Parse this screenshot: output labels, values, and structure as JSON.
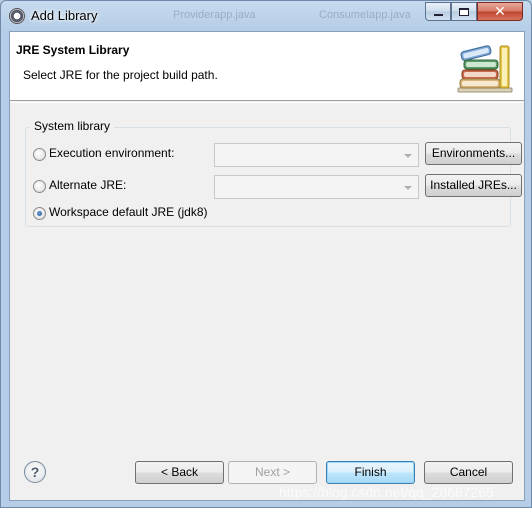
{
  "window": {
    "title": "Add Library",
    "background_tabs": [
      "Providerapp.java",
      "ConsumeIapp.java"
    ]
  },
  "header": {
    "title": "JRE System Library",
    "description": "Select JRE for the project build path."
  },
  "group": {
    "label": "System library",
    "options": [
      {
        "label": "Execution environment:",
        "checked": false,
        "combo_value": "",
        "button": "Environments..."
      },
      {
        "label": "Alternate JRE:",
        "checked": false,
        "combo_value": "",
        "button": "Installed JREs..."
      },
      {
        "label": "Workspace default JRE (jdk8)",
        "checked": true
      }
    ]
  },
  "footer": {
    "back": "< Back",
    "next": "Next >",
    "finish": "Finish",
    "cancel": "Cancel",
    "help": "?"
  },
  "watermark": "https://blog.csdn.net/qq_28687265",
  "icons": [
    "app-icon",
    "minimize-icon",
    "maximize-icon",
    "close-icon",
    "books-icon",
    "help-icon",
    "chevron-down-icon"
  ],
  "colors": {
    "accent": "#3c7fb1",
    "close": "#c0452e",
    "dialog_bg": "#f0f0f0"
  }
}
